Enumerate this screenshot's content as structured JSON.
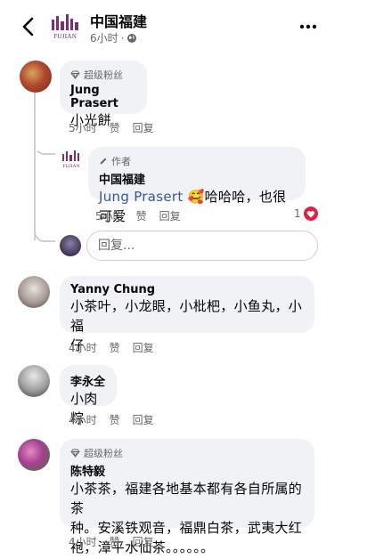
{
  "header": {
    "page_name": "中国福建",
    "time": "6小时",
    "logo_text": "FUJIAN"
  },
  "comments": [
    {
      "badge": "超级粉丝",
      "author": "Jung Prasert",
      "text": "小光餅",
      "time": "5小时",
      "like": "赞",
      "reply": "回复"
    },
    {
      "badge": "作者",
      "author": "中国福建",
      "mention": "Jung Prasert",
      "emoji": "🥰",
      "text": "哈哈哈，也很可爱",
      "time": "5小时",
      "like": "赞",
      "reply": "回复",
      "reaction_count": "1"
    },
    {
      "author": "Yanny Chung",
      "text_line1": "小茶叶，小龙眼，小枇杷，小鱼丸，小福",
      "text_line2": "仔",
      "time": "4小时",
      "like": "赞",
      "reply": "回复"
    },
    {
      "author": "李永全",
      "text": "小肉粽",
      "time": "4小时",
      "like": "赞",
      "reply": "回复"
    },
    {
      "badge": "超级粉丝",
      "author": "陈特毅",
      "text_line1": "小茶茶，福建各地基本都有各自所属的茶",
      "text_line2": "种。安溪铁观音，福鼎白茶，武夷大红",
      "text_line3": "袍，漳平水仙茶。。。。。。",
      "time": "4小时",
      "like": "赞",
      "reply": "回复"
    }
  ],
  "reply_box": {
    "placeholder": "回复..."
  },
  "colors": {
    "bubble": "#f0f2f5",
    "meta": "#65676b",
    "mention": "#385898",
    "heart": "#e41e3f"
  }
}
